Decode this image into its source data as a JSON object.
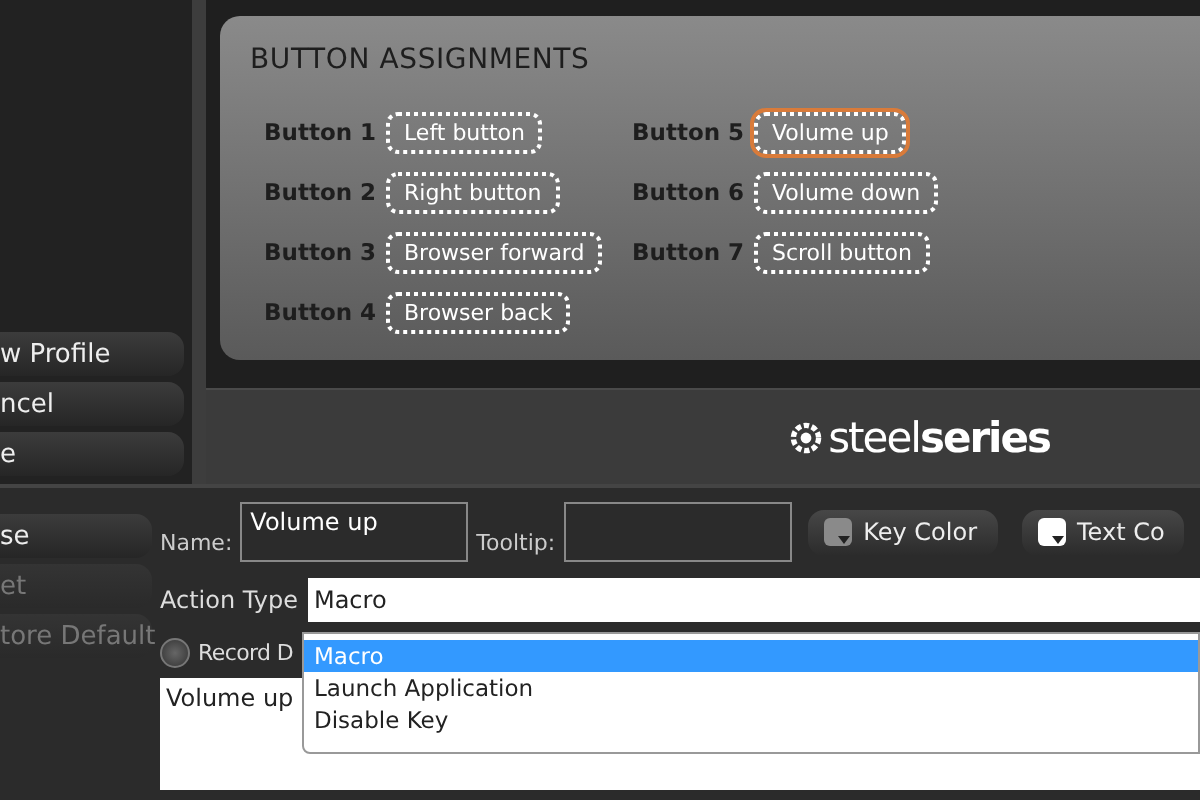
{
  "sidebar": {
    "buttons": [
      {
        "label": "w Profile",
        "disabled": false
      },
      {
        "label": "ncel",
        "disabled": false
      },
      {
        "label": "e",
        "disabled": false
      }
    ]
  },
  "assignments": {
    "title": "BUTTON ASSIGNMENTS",
    "buttons": [
      {
        "label": "Button 1",
        "action": "Left button",
        "selected": false
      },
      {
        "label": "Button 2",
        "action": "Right button",
        "selected": false
      },
      {
        "label": "Button 3",
        "action": "Browser forward",
        "selected": false
      },
      {
        "label": "Button 4",
        "action": "Browser back",
        "selected": false
      },
      {
        "label": "Button 5",
        "action": "Volume up",
        "selected": true
      },
      {
        "label": "Button 6",
        "action": "Volume down",
        "selected": false
      },
      {
        "label": "Button 7",
        "action": "Scroll button",
        "selected": false
      }
    ]
  },
  "brand": "steel**series**",
  "editor": {
    "side_buttons": [
      {
        "label": "se",
        "disabled": false
      },
      {
        "label": "et",
        "disabled": true
      },
      {
        "label": "tore Default",
        "disabled": true
      }
    ],
    "name": {
      "label": "Name:",
      "value": "Volume up"
    },
    "tooltip": {
      "label": "Tooltip:"
    },
    "color_buttons": [
      {
        "label": "Key Color",
        "color": "#8a8a8a"
      },
      {
        "label": "Text Co",
        "color": "#ffffff"
      }
    ],
    "action_type": {
      "label": "Action Type",
      "value": "Macro",
      "options": [
        {
          "label": "Macro",
          "selected": true
        },
        {
          "label": "Launch Application",
          "selected": false
        },
        {
          "label": "Disable Key",
          "selected": false
        }
      ]
    },
    "record": {
      "label": "Record D",
      "checked": false
    },
    "macro_text": "Volume up"
  }
}
